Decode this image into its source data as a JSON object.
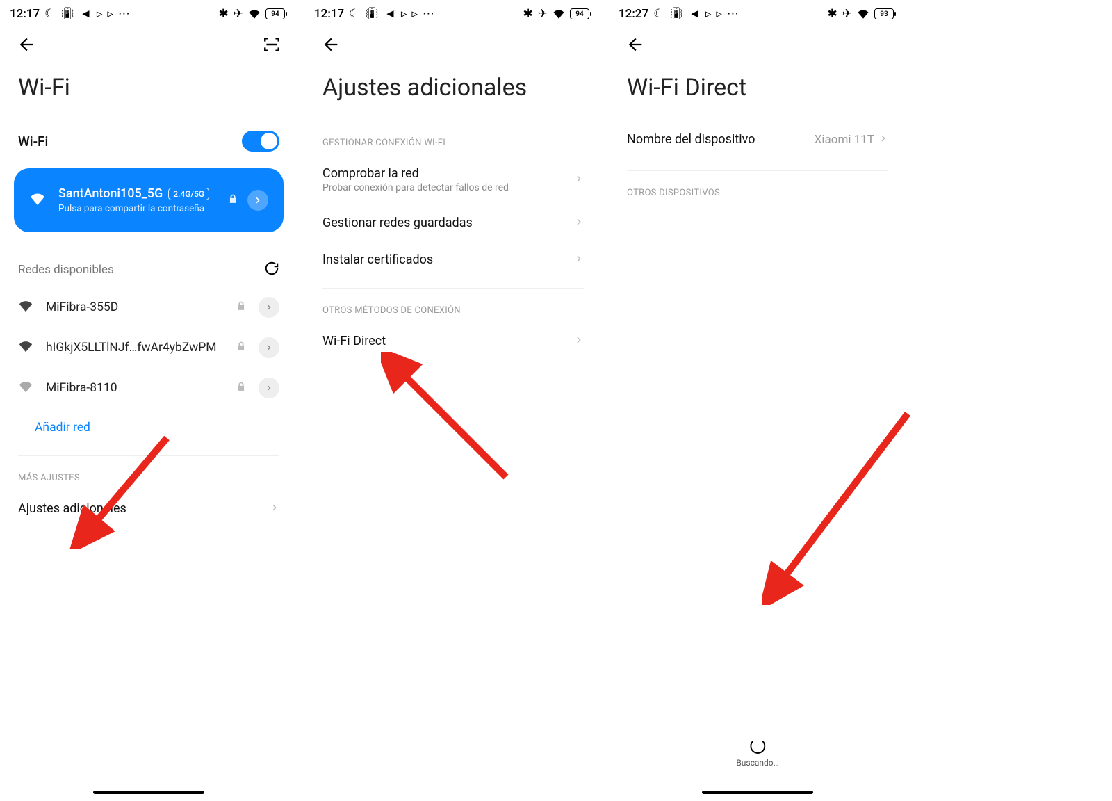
{
  "status": {
    "time1": "12:17",
    "time2": "12:17",
    "time3": "12:27",
    "battery1": "94",
    "battery2": "94",
    "battery3": "93"
  },
  "screen1": {
    "title": "Wi-Fi",
    "wifi_label": "Wi-Fi",
    "connected": {
      "name": "SantAntoni105_5G",
      "band": "2.4G/5G",
      "hint": "Pulsa para compartir la contraseña"
    },
    "available_header": "Redes disponibles",
    "networks": [
      {
        "name": "MiFibra-355D"
      },
      {
        "name": "hIGkjX5LLTlNJf…fwAr4ybZwPM"
      },
      {
        "name": "MiFibra-8110"
      }
    ],
    "add_network": "Añadir red",
    "more_header": "MÁS AJUSTES",
    "additional": "Ajustes adicionales"
  },
  "screen2": {
    "title": "Ajustes adicionales",
    "sec1": "GESTIONAR CONEXIÓN WI-FI",
    "items1": [
      {
        "label": "Comprobar la red",
        "sub": "Probar conexión para detectar fallos de red"
      },
      {
        "label": "Gestionar redes guardadas",
        "sub": ""
      },
      {
        "label": "Instalar certificados",
        "sub": ""
      }
    ],
    "sec2": "OTROS MÉTODOS DE CONEXIÓN",
    "wifi_direct": "Wi-Fi Direct"
  },
  "screen3": {
    "title": "Wi-Fi Direct",
    "device_label": "Nombre del dispositivo",
    "device_value": "Xiaomi 11T",
    "other_devices": "OTROS DISPOSITIVOS",
    "searching": "Buscando…"
  }
}
